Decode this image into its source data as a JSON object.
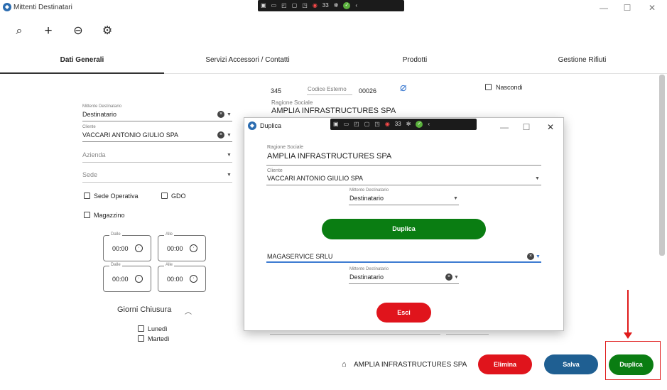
{
  "window": {
    "title": "Mittenti Destinatari",
    "controls": {
      "minimize": "—",
      "maximize": "☐",
      "close": "✕"
    }
  },
  "recorder": {
    "counter": "33"
  },
  "toolbar": {
    "icons": [
      "search-icon",
      "add-icon",
      "link-icon",
      "gear-icon"
    ],
    "search": "⌕",
    "add": "+",
    "link": "⊖",
    "settings": "⚙"
  },
  "tabs": [
    {
      "label": "Dati Generali",
      "active": true
    },
    {
      "label": "Servizi Accessori / Contatti",
      "active": false
    },
    {
      "label": "Prodotti",
      "active": false
    },
    {
      "label": "Gestione Rifiuti",
      "active": false
    }
  ],
  "left_form": {
    "mittente_destinatario": {
      "label": "Mittente Destinatario",
      "value": "Destinatario"
    },
    "cliente": {
      "label": "Cliente",
      "value": "VACCARI ANTONIO GIULIO SPA"
    },
    "azienda": {
      "placeholder": "Azienda"
    },
    "sede": {
      "placeholder": "Sede"
    },
    "checkboxes": {
      "sede_operativa": "Sede Operativa",
      "gdo": "GDO",
      "magazzino": "Magazzino"
    },
    "times": [
      {
        "label": "Dalle",
        "value": "00:00"
      },
      {
        "label": "Alle",
        "value": "00:00"
      },
      {
        "label": "Dalle",
        "value": "00:00"
      },
      {
        "label": "Alle",
        "value": "00:00"
      }
    ],
    "giorni_chiusura": {
      "title": "Giorni Chiusura",
      "days": [
        "Lunedì",
        "Martedì"
      ]
    }
  },
  "right_form": {
    "id": "345",
    "codice_esterno": {
      "label": "Codice Esterno",
      "value": "00026"
    },
    "nascondi": "Nascondi",
    "ragione_sociale": {
      "label": "Ragione Sociale",
      "value": "AMPLIA INFRASTRUCTURES SPA"
    }
  },
  "footer": {
    "company": "AMPLIA INFRASTRUCTURES SPA",
    "buttons": {
      "elimina": "Elimina",
      "salva": "Salva",
      "duplica": "Duplica"
    }
  },
  "dialog": {
    "title": "Duplica",
    "ragione_sociale": {
      "label": "Ragione Sociale",
      "value": "AMPLIA INFRASTRUCTURES SPA"
    },
    "cliente": {
      "label": "Cliente",
      "value": "VACCARI ANTONIO GIULIO SPA"
    },
    "mittente1": {
      "label": "Mittente Destinatario",
      "value": "Destinatario"
    },
    "duplica_button": "Duplica",
    "search_value": "MAGASERVICE SRLU",
    "mittente2": {
      "label": "Mittente Destinatario",
      "value": "Destinatario"
    },
    "esci_button": "Esci"
  },
  "colors": {
    "green": "#0a7d12",
    "red": "#e0141c",
    "blue": "#1f5f92",
    "annotation": "#e01b1b"
  }
}
